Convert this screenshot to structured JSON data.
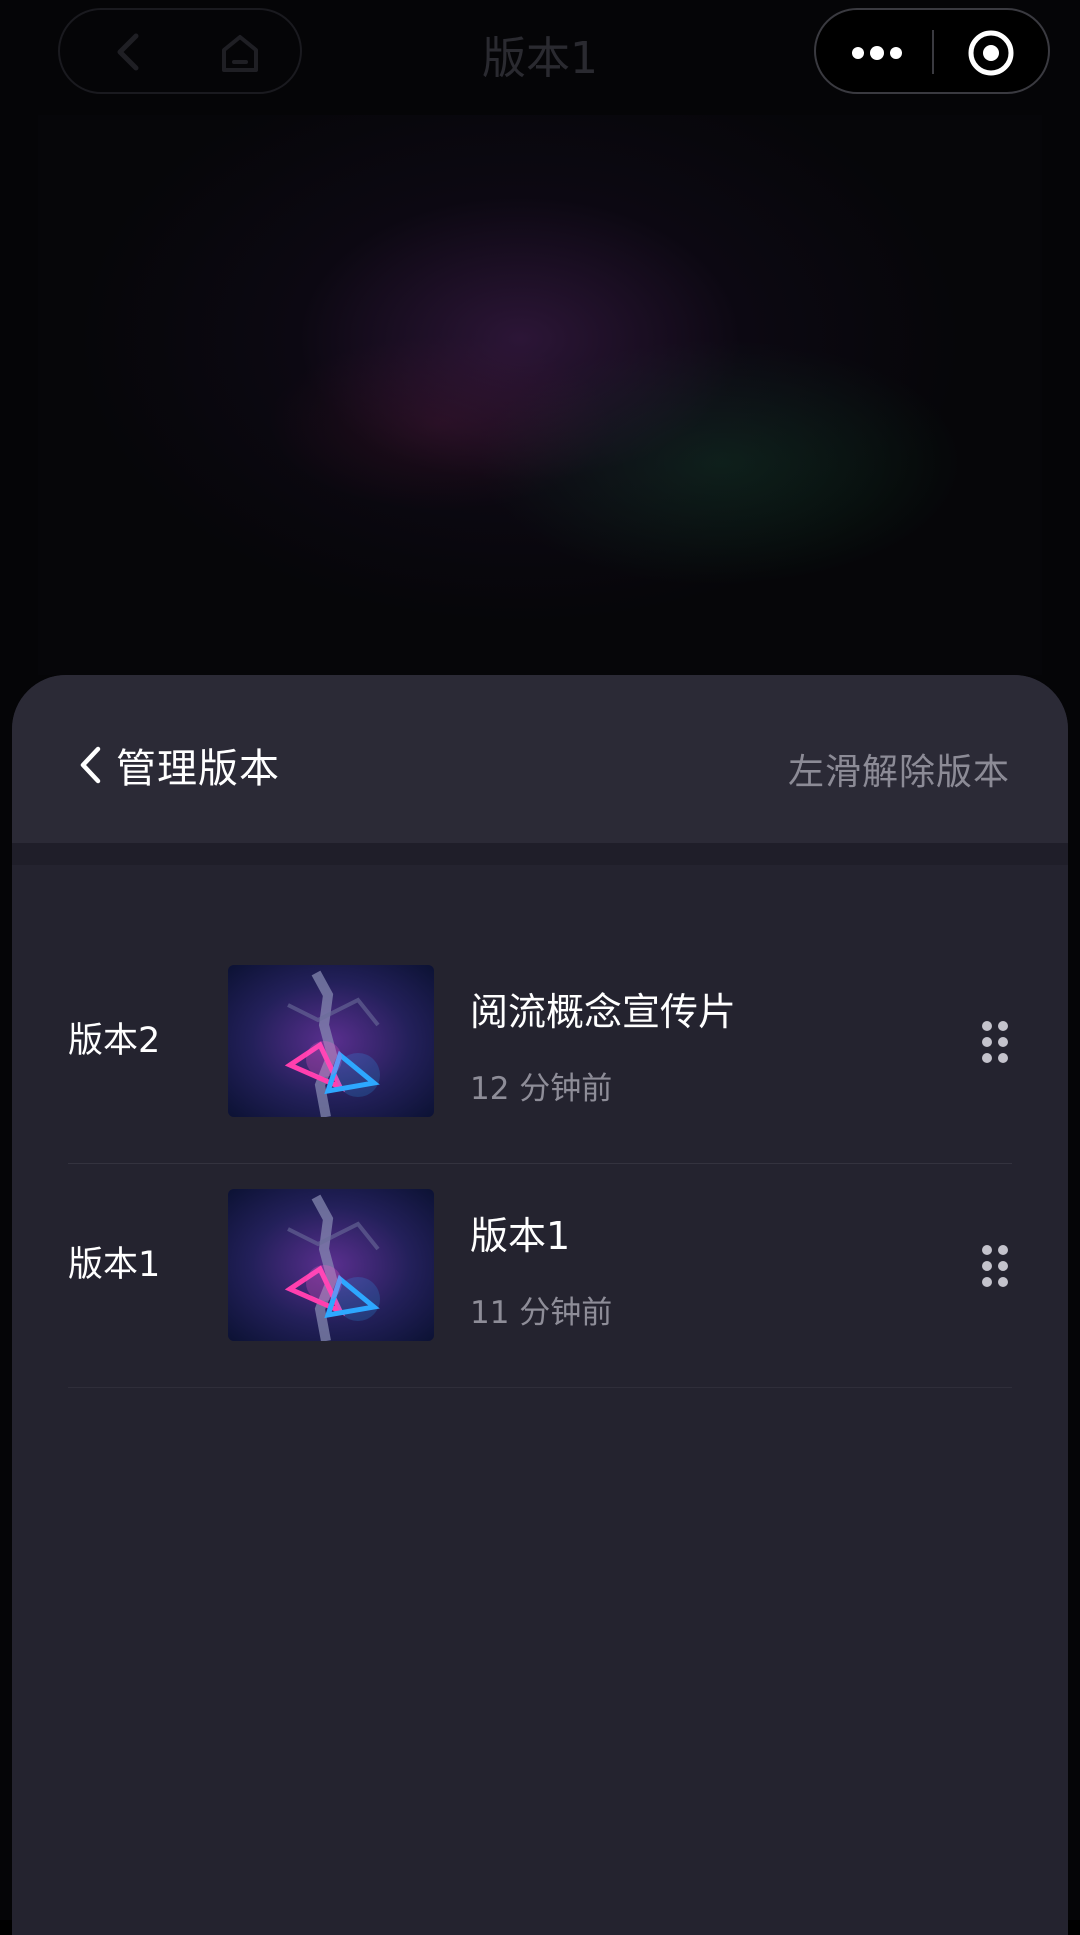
{
  "nav": {
    "title": "版本1"
  },
  "sheet": {
    "title": "管理版本",
    "hint": "左滑解除版本"
  },
  "versions": [
    {
      "label": "版本2",
      "title": "阅流概念宣传片",
      "time": "12 分钟前"
    },
    {
      "label": "版本1",
      "title": "版本1",
      "time": "11 分钟前"
    }
  ],
  "icons": {
    "back": "chevron-left-icon",
    "home": "home-icon",
    "more": "more-dots-icon",
    "target": "target-icon",
    "drag": "drag-handle-icon"
  },
  "colors": {
    "sheet_bg": "#24232f",
    "header_bg": "#2b2a36",
    "muted_text": "#8e8d98",
    "thumb_pink": "#ff3fae",
    "thumb_blue": "#2ea8ff"
  }
}
